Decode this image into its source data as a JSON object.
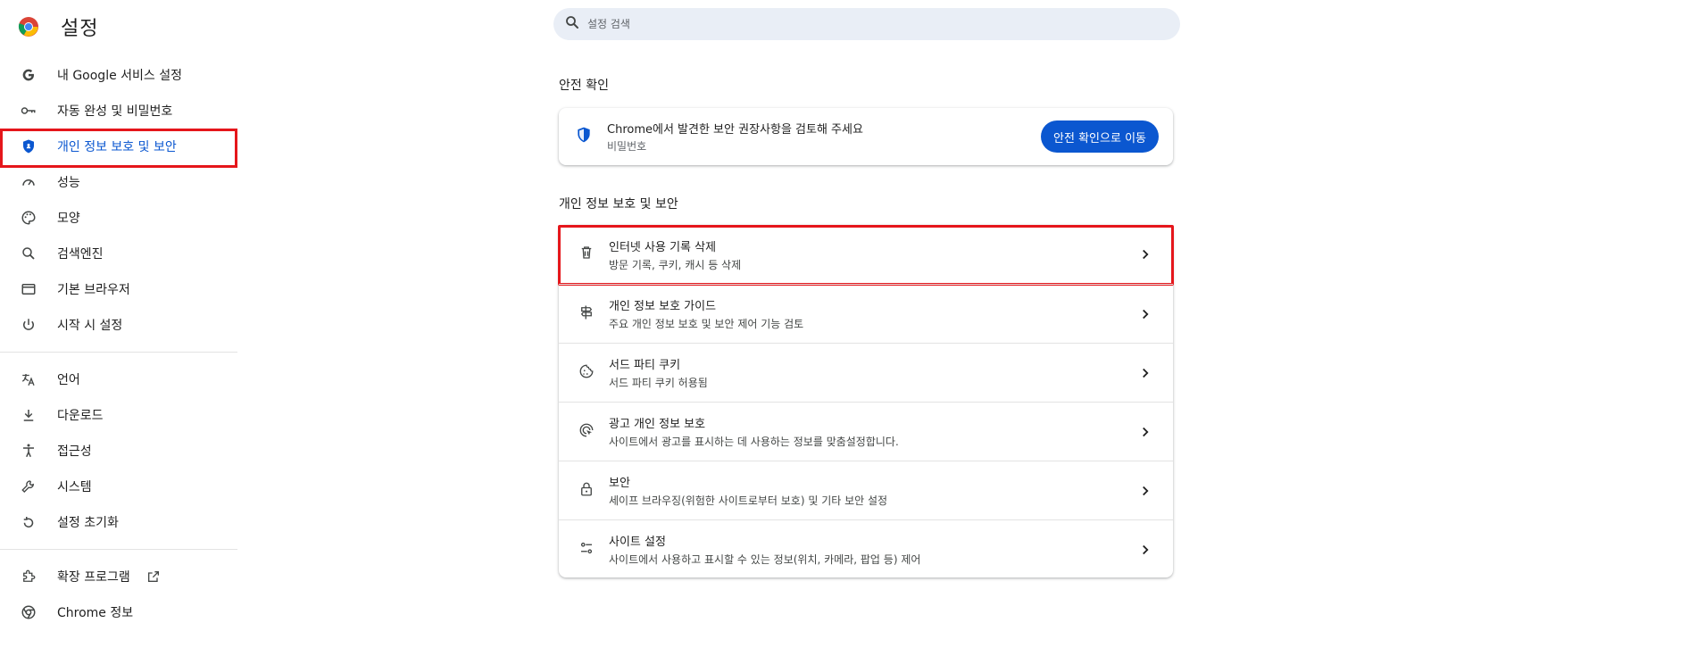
{
  "header": {
    "title": "설정",
    "logo": "chrome-logo-icon",
    "search_placeholder": "설정 검색"
  },
  "sidebar": {
    "items": [
      {
        "label": "내 Google 서비스 설정",
        "icon": "google-g-icon"
      },
      {
        "label": "자동 완성 및 비밀번호",
        "icon": "key-icon"
      },
      {
        "label": "개인 정보 보호 및 보안",
        "icon": "shield-icon",
        "active": true
      },
      {
        "label": "성능",
        "icon": "speedometer-icon"
      },
      {
        "label": "모양",
        "icon": "palette-icon"
      },
      {
        "label": "검색엔진",
        "icon": "search-icon"
      },
      {
        "label": "기본 브라우저",
        "icon": "browser-window-icon"
      },
      {
        "label": "시작 시 설정",
        "icon": "power-icon"
      }
    ],
    "items2": [
      {
        "label": "언어",
        "icon": "translate-icon"
      },
      {
        "label": "다운로드",
        "icon": "download-icon"
      },
      {
        "label": "접근성",
        "icon": "accessibility-icon"
      },
      {
        "label": "시스템",
        "icon": "wrench-icon"
      },
      {
        "label": "설정 초기화",
        "icon": "reset-icon"
      }
    ],
    "items3": [
      {
        "label": "확장 프로그램",
        "icon": "puzzle-icon"
      },
      {
        "label": "Chrome 정보",
        "icon": "chrome-icon"
      }
    ]
  },
  "safety_check": {
    "section_title": "안전 확인",
    "title": "Chrome에서 발견한 보안 권장사항을 검토해 주세요",
    "subtitle": "비밀번호",
    "button_label": "안전 확인으로 이동"
  },
  "privacy": {
    "section_title": "개인 정보 보호 및 보안",
    "rows": [
      {
        "title": "인터넷 사용 기록 삭제",
        "subtitle": "방문 기록, 쿠키, 캐시 등 삭제",
        "icon": "trash-icon",
        "highlighted": true
      },
      {
        "title": "개인 정보 보호 가이드",
        "subtitle": "주요 개인 정보 보호 및 보안 제어 기능 검토",
        "icon": "signpost-icon"
      },
      {
        "title": "서드 파티 쿠키",
        "subtitle": "서드 파티 쿠키 허용됨",
        "icon": "cookie-icon"
      },
      {
        "title": "광고 개인 정보 보호",
        "subtitle": "사이트에서 광고를 표시하는 데 사용하는 정보를 맞춤설정합니다.",
        "icon": "ad-target-icon"
      },
      {
        "title": "보안",
        "subtitle": "세이프 브라우징(위험한 사이트로부터 보호) 및 기타 보안 설정",
        "icon": "lock-icon"
      },
      {
        "title": "사이트 설정",
        "subtitle": "사이트에서 사용하고 표시할 수 있는 정보(위치, 카메라, 팝업 등) 제어",
        "icon": "tune-icon"
      }
    ]
  },
  "colors": {
    "accent": "#0b57d0",
    "highlight": "#e5161b",
    "active_bg": "#d3e3fd",
    "search_bg": "#e9eef6"
  }
}
